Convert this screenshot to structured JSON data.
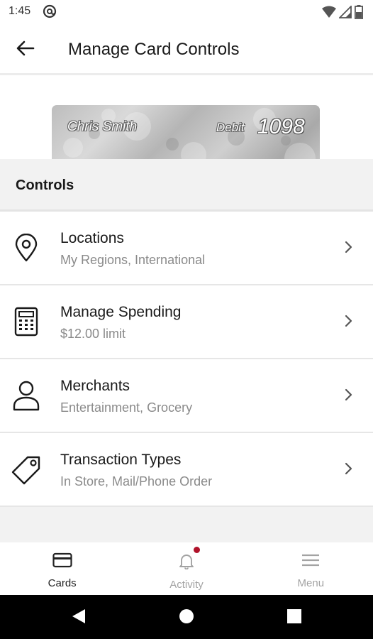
{
  "status_bar": {
    "time": "1:45"
  },
  "app_bar": {
    "title": "Manage Card Controls"
  },
  "card": {
    "holder_name": "Chris Smith",
    "type": "Debit",
    "last_four": "1098"
  },
  "controls": {
    "header": "Controls",
    "items": [
      {
        "icon": "location-pin-icon",
        "title": "Locations",
        "subtitle": "My Regions, International"
      },
      {
        "icon": "calculator-icon",
        "title": "Manage Spending",
        "subtitle": "$12.00 limit"
      },
      {
        "icon": "person-icon",
        "title": "Merchants",
        "subtitle": "Entertainment, Grocery"
      },
      {
        "icon": "tag-icon",
        "title": "Transaction Types",
        "subtitle": "In Store, Mail/Phone Order"
      }
    ]
  },
  "bottom_nav": {
    "tabs": [
      {
        "label": "Cards",
        "icon": "card-icon",
        "active": true
      },
      {
        "label": "Activity",
        "icon": "bell-icon",
        "active": false,
        "badge": true
      },
      {
        "label": "Menu",
        "icon": "hamburger-icon",
        "active": false
      }
    ]
  },
  "colors": {
    "accent": "#b0122a",
    "section_bg": "#f2f2f2",
    "subtitle": "#8a8a8a"
  }
}
